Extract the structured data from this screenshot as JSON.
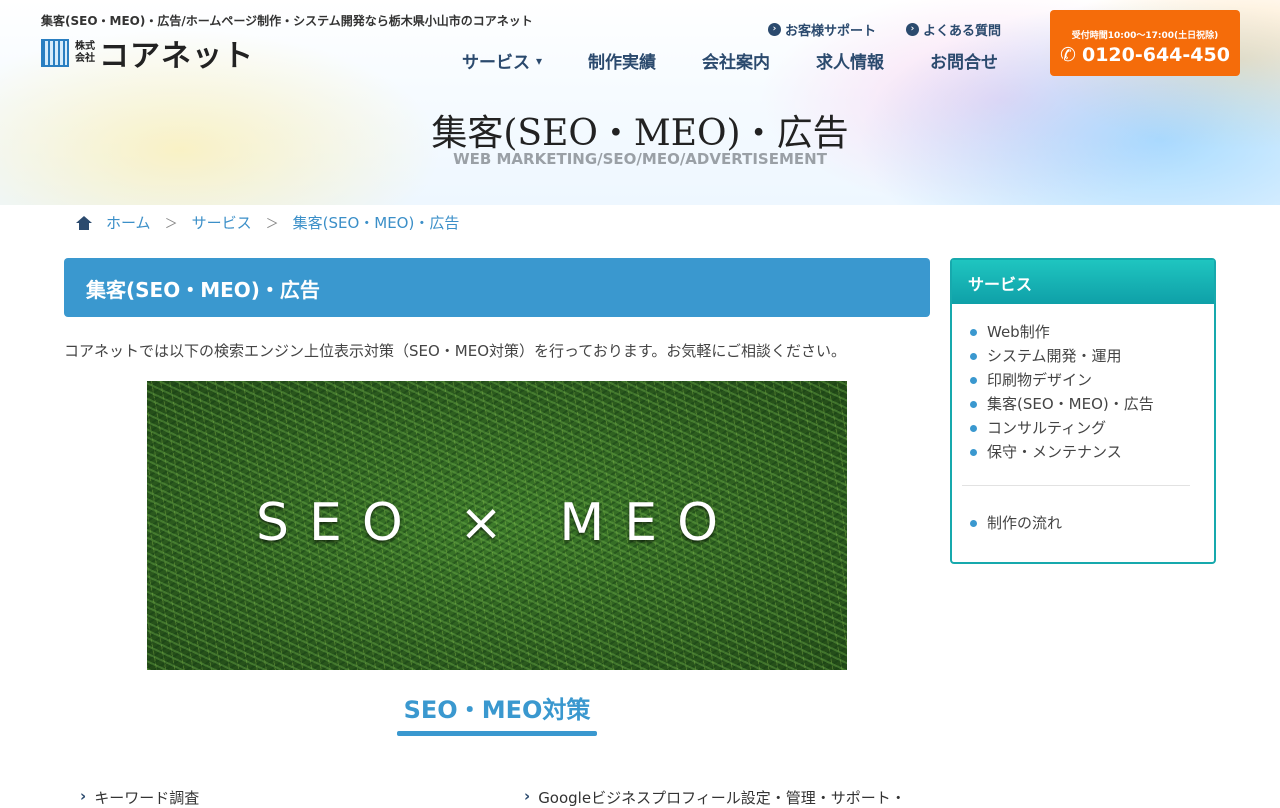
{
  "header": {
    "tagline": "集客(SEO・MEO)・広告/ホームページ制作・システム開発なら栃木県小山市のコアネット",
    "logo": {
      "small_top": "株式",
      "small_bottom": "会社",
      "name": "コアネット"
    },
    "top_links": [
      {
        "label": "お客様サポート",
        "icon": "circle-chevron-right-icon"
      },
      {
        "label": "よくある質問",
        "icon": "circle-chevron-right-icon"
      }
    ],
    "nav": [
      {
        "label": "サービス",
        "has_dropdown": true
      },
      {
        "label": "制作実績"
      },
      {
        "label": "会社案内"
      },
      {
        "label": "求人情報"
      },
      {
        "label": "お問合せ"
      }
    ],
    "contact": {
      "hours": "受付時間10:00〜17:00(土日祝除)",
      "phone": "0120-644-450",
      "color": "#f56c0a"
    }
  },
  "hero": {
    "title": "集客(SEO・MEO)・広告",
    "subtitle": "WEB MARKETING/SEO/MEO/ADVERTISEMENT"
  },
  "breadcrumb": [
    "ホーム",
    "サービス",
    "集客(SEO・MEO)・広告"
  ],
  "main": {
    "section_title": "集客(SEO・MEO)・広告",
    "intro": "コアネットでは以下の検索エンジン上位表示対策（SEO・MEO対策）を行っております。お気軽にご相談ください。",
    "image_text": "SEO × MEO",
    "sub_heading": "SEO・MEO対策",
    "features": [
      "キーワード調査",
      "Googleビジネスプロフィール設定・管理・サポート・"
    ],
    "accent_color": "#3a98cf"
  },
  "sidebar": {
    "title": "サービス",
    "items": [
      "Web制作",
      "システム開発・運用",
      "印刷物デザイン",
      "集客(SEO・MEO)・広告",
      "コンサルティング",
      "保守・メンテナンス"
    ],
    "extra_items": [
      "制作の流れ"
    ],
    "accent_color": "#17a9ad"
  }
}
